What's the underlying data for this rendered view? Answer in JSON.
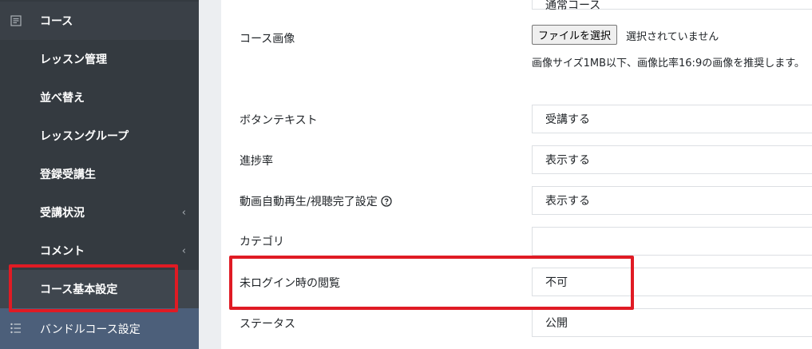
{
  "sidebar": {
    "items": [
      {
        "label": "コース"
      },
      {
        "label": "レッスン管理"
      },
      {
        "label": "並べ替え"
      },
      {
        "label": "レッスングループ"
      },
      {
        "label": "登録受講生"
      },
      {
        "label": "受講状況",
        "chevron": "‹"
      },
      {
        "label": "コメント",
        "chevron": "‹"
      },
      {
        "label": "コース基本設定"
      },
      {
        "label": "バンドルコース設定"
      }
    ]
  },
  "form": {
    "top_partial_value": "通常コース",
    "course_image": {
      "label": "コース画像",
      "file_button": "ファイルを選択",
      "file_status": "選択されていません",
      "hint": "画像サイズ1MB以下、画像比率16:9の画像を推奨します。"
    },
    "fields": [
      {
        "label": "ボタンテキスト",
        "value": "受講する"
      },
      {
        "label": "進捗率",
        "value": "表示する"
      },
      {
        "label": "動画自動再生/視聴完了設定",
        "value": "表示する"
      },
      {
        "label": "カテゴリ",
        "value": ""
      },
      {
        "label": "未ログイン時の閲覧",
        "value": "不可"
      },
      {
        "label": "ステータス",
        "value": "公開"
      }
    ]
  },
  "icons": {
    "course": "document-icon",
    "bundle": "list-icon",
    "help": "question-circle-icon"
  },
  "colors": {
    "sidebar_bg": "#343a40",
    "highlight": "#e01b24",
    "bundle_bg": "#4c5f7a"
  }
}
